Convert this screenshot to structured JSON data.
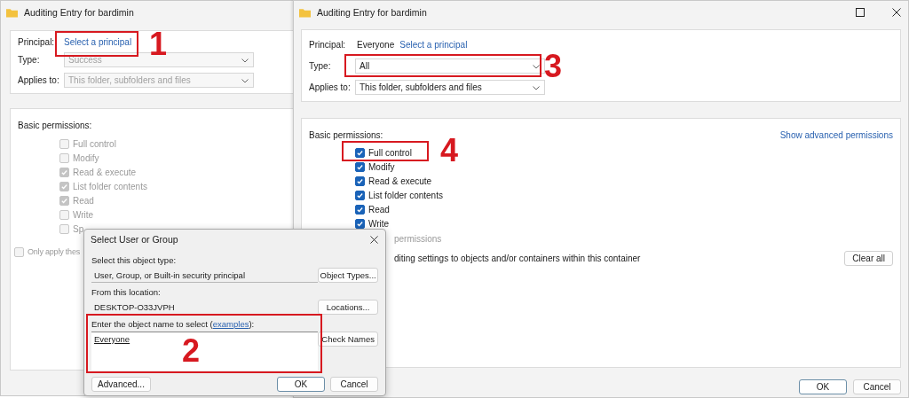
{
  "left_window": {
    "title": "Auditing Entry for bardimin",
    "principal_label": "Principal:",
    "principal_link": "Select a principal",
    "type_label": "Type:",
    "type": {
      "value": "Success",
      "disabled": true
    },
    "applies_label": "Applies to:",
    "applies": {
      "value": "This folder, subfolders and files",
      "disabled": true
    },
    "permissions_label": "Basic permissions:",
    "permissions": [
      {
        "label": "Full control",
        "checked": false,
        "disabled": true
      },
      {
        "label": "Modify",
        "checked": false,
        "disabled": true
      },
      {
        "label": "Read & execute",
        "checked": true,
        "disabled": true
      },
      {
        "label": "List folder contents",
        "checked": true,
        "disabled": true
      },
      {
        "label": "Read",
        "checked": true,
        "disabled": true
      },
      {
        "label": "Write",
        "checked": false,
        "disabled": true
      },
      {
        "label": "Sp",
        "checked": false,
        "disabled": true
      }
    ],
    "only_apply": {
      "label": "Only apply thes",
      "checked": false,
      "disabled": true
    }
  },
  "right_window": {
    "title": "Auditing Entry for bardimin",
    "principal_label": "Principal:",
    "principal_value": "Everyone",
    "principal_link": "Select a principal",
    "type_label": "Type:",
    "type": {
      "value": "All",
      "disabled": false
    },
    "applies_label": "Applies to:",
    "applies": {
      "value": "This folder, subfolders and files",
      "disabled": false
    },
    "permissions_label": "Basic permissions:",
    "advanced_link": "Show advanced permissions",
    "permissions": [
      {
        "label": "Full control",
        "checked": true,
        "disabled": false
      },
      {
        "label": "Modify",
        "checked": true,
        "disabled": false
      },
      {
        "label": "Read & execute",
        "checked": true,
        "disabled": false
      },
      {
        "label": "List folder contents",
        "checked": true,
        "disabled": false
      },
      {
        "label": "Read",
        "checked": true,
        "disabled": false
      },
      {
        "label": "Write",
        "checked": true,
        "disabled": false
      }
    ],
    "special_text": "permissions",
    "apply_text": "diting settings to objects and/or containers within this container",
    "clear_all": "Clear all",
    "buttons": [
      {
        "label": "OK",
        "default": true
      },
      {
        "label": "Cancel",
        "default": false
      }
    ]
  },
  "dialog": {
    "title": "Select User or Group",
    "object_type_label": "Select this object type:",
    "object_type_value": "User, Group, or Built-in security principal",
    "object_types_button": "Object Types...",
    "location_label": "From this location:",
    "location_value": "DESKTOP-O33JVPH",
    "locations_button": "Locations...",
    "name_label_before": "Enter the object name to select (",
    "name_label_link": "examples",
    "name_label_after": "):",
    "name_value": "Everyone",
    "check_names_button": "Check Names",
    "advanced_button": "Advanced...",
    "buttons": [
      {
        "label": "OK",
        "default": true
      },
      {
        "label": "Cancel",
        "default": false
      }
    ]
  },
  "annotations": [
    {
      "label": "1"
    },
    {
      "label": "2"
    },
    {
      "label": "3"
    },
    {
      "label": "4"
    }
  ]
}
